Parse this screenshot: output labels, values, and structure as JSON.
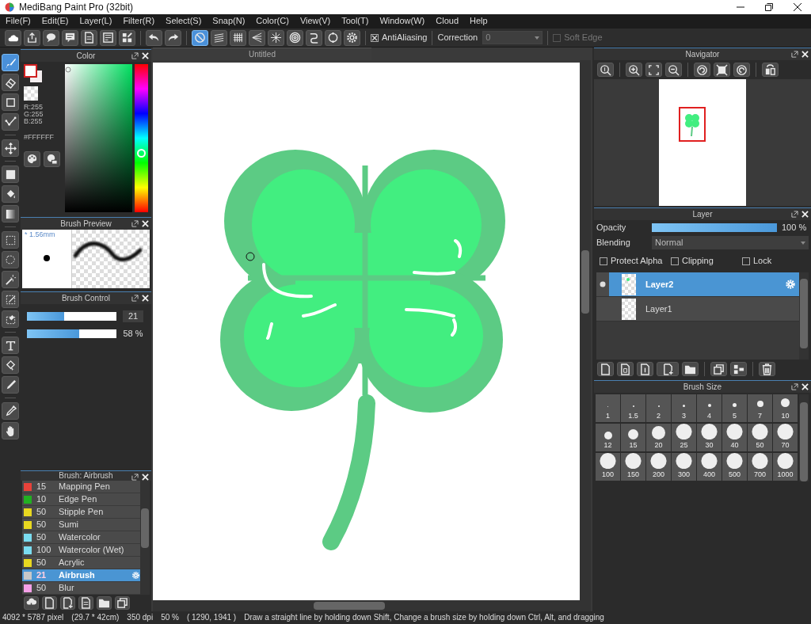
{
  "window": {
    "title": "MediBang Paint Pro (32bit)"
  },
  "menu": [
    "File(F)",
    "Edit(E)",
    "Layer(L)",
    "Filter(R)",
    "Select(S)",
    "Snap(N)",
    "Color(C)",
    "View(V)",
    "Tool(T)",
    "Window(W)",
    "Cloud",
    "Help"
  ],
  "toolbar": {
    "snap_tools": [
      {
        "kind": "off",
        "selected": true
      },
      {
        "kind": "parallel",
        "selected": false
      },
      {
        "kind": "grid",
        "selected": false
      },
      {
        "kind": "perspective",
        "selected": false
      },
      {
        "kind": "radial",
        "selected": false
      },
      {
        "kind": "concentric",
        "selected": false
      },
      {
        "kind": "curve",
        "selected": false
      },
      {
        "kind": "circle",
        "selected": false
      },
      {
        "kind": "settings",
        "selected": false
      }
    ],
    "antialiasing": {
      "label": "AntiAliasing",
      "checked": true
    },
    "correction": {
      "label": "Correction",
      "value": "0"
    },
    "soft_edge": {
      "label": "Soft Edge",
      "checked": false,
      "disabled": true
    }
  },
  "tools": [
    {
      "kind": "brush",
      "selected": true
    },
    {
      "kind": "eraser",
      "selected": false
    },
    {
      "kind": "rect",
      "selected": false
    },
    {
      "kind": "polyline",
      "selected": false
    },
    {
      "kind": "move",
      "selected": false
    },
    {
      "kind": "fill-rect",
      "selected": false
    },
    {
      "kind": "bucket",
      "selected": false
    },
    {
      "kind": "gradient",
      "selected": false
    },
    {
      "kind": "select-rect",
      "selected": false
    },
    {
      "kind": "lasso",
      "selected": false
    },
    {
      "kind": "wand",
      "selected": false
    },
    {
      "kind": "select-pen",
      "selected": false
    },
    {
      "kind": "select-eraser",
      "selected": false
    },
    {
      "kind": "text",
      "selected": false
    },
    {
      "kind": "divide",
      "selected": false
    },
    {
      "kind": "pen",
      "selected": false
    },
    {
      "kind": "dropper",
      "selected": false
    },
    {
      "kind": "hand",
      "selected": false
    }
  ],
  "color_panel": {
    "title": "Color",
    "rgb": [
      "R:255",
      "G:255",
      "B:255"
    ],
    "hex": "#FFFFFF",
    "hue": {
      "level": 0.4
    }
  },
  "brush_preview": {
    "title": "Brush Preview",
    "size": "* 1.56mm"
  },
  "brush_control": {
    "title": "Brush Control",
    "size": {
      "level": 0.42,
      "value": "21"
    },
    "opacity": {
      "level": 0.58,
      "value": "58 %"
    }
  },
  "brush_list": {
    "title": "Brush: Airbrush",
    "items": [
      {
        "color": "#e8423a",
        "size": "15",
        "name": "Mapping Pen",
        "selected": false
      },
      {
        "color": "#22b022",
        "size": "10",
        "name": "Edge Pen",
        "selected": false
      },
      {
        "color": "#e8d820",
        "size": "50",
        "name": "Stipple Pen",
        "selected": false
      },
      {
        "color": "#e8d820",
        "size": "50",
        "name": "Sumi",
        "selected": false
      },
      {
        "color": "#7adcf0",
        "size": "50",
        "name": "Watercolor",
        "selected": false
      },
      {
        "color": "#7adcf0",
        "size": "100",
        "name": "Watercolor (Wet)",
        "selected": false
      },
      {
        "color": "#e8d820",
        "size": "50",
        "name": "Acrylic",
        "selected": false
      },
      {
        "color": "#c8c8c8",
        "size": "21",
        "name": "Airbrush",
        "selected": true
      },
      {
        "color": "#f5a0e8",
        "size": "50",
        "name": "Blur",
        "selected": false
      }
    ]
  },
  "canvas": {
    "tab": "Untitled"
  },
  "navigator": {
    "title": "Navigator"
  },
  "layer_panel": {
    "title": "Layer",
    "opacity": {
      "label": "Opacity",
      "level": 1,
      "value": "100 %"
    },
    "blending": {
      "label": "Blending",
      "value": "Normal"
    },
    "options": [
      {
        "label": "Protect Alpha",
        "checked": false
      },
      {
        "label": "Clipping",
        "checked": false
      },
      {
        "label": "Lock",
        "checked": false
      }
    ],
    "layers": [
      {
        "name": "Layer2",
        "selected": true,
        "visible": true
      },
      {
        "name": "Layer1",
        "selected": false,
        "visible": false
      }
    ]
  },
  "brush_size": {
    "title": "Brush Size",
    "sizes": [
      "1",
      "1.5",
      "2",
      "3",
      "4",
      "5",
      "7",
      "10",
      "12",
      "15",
      "20",
      "25",
      "30",
      "40",
      "50",
      "70",
      "100",
      "150",
      "200",
      "300",
      "400",
      "500",
      "700",
      "1000"
    ]
  },
  "status_bar": {
    "size": "4092 * 5787 pixel",
    "paper": "(29.7 * 42cm)",
    "dpi": "350 dpi",
    "zoom": "50 %",
    "coords": "( 1290, 1941 )",
    "hint": "Draw a straight line by holding down Shift, Change a brush size by holding down Ctrl, Alt, and dragging"
  }
}
